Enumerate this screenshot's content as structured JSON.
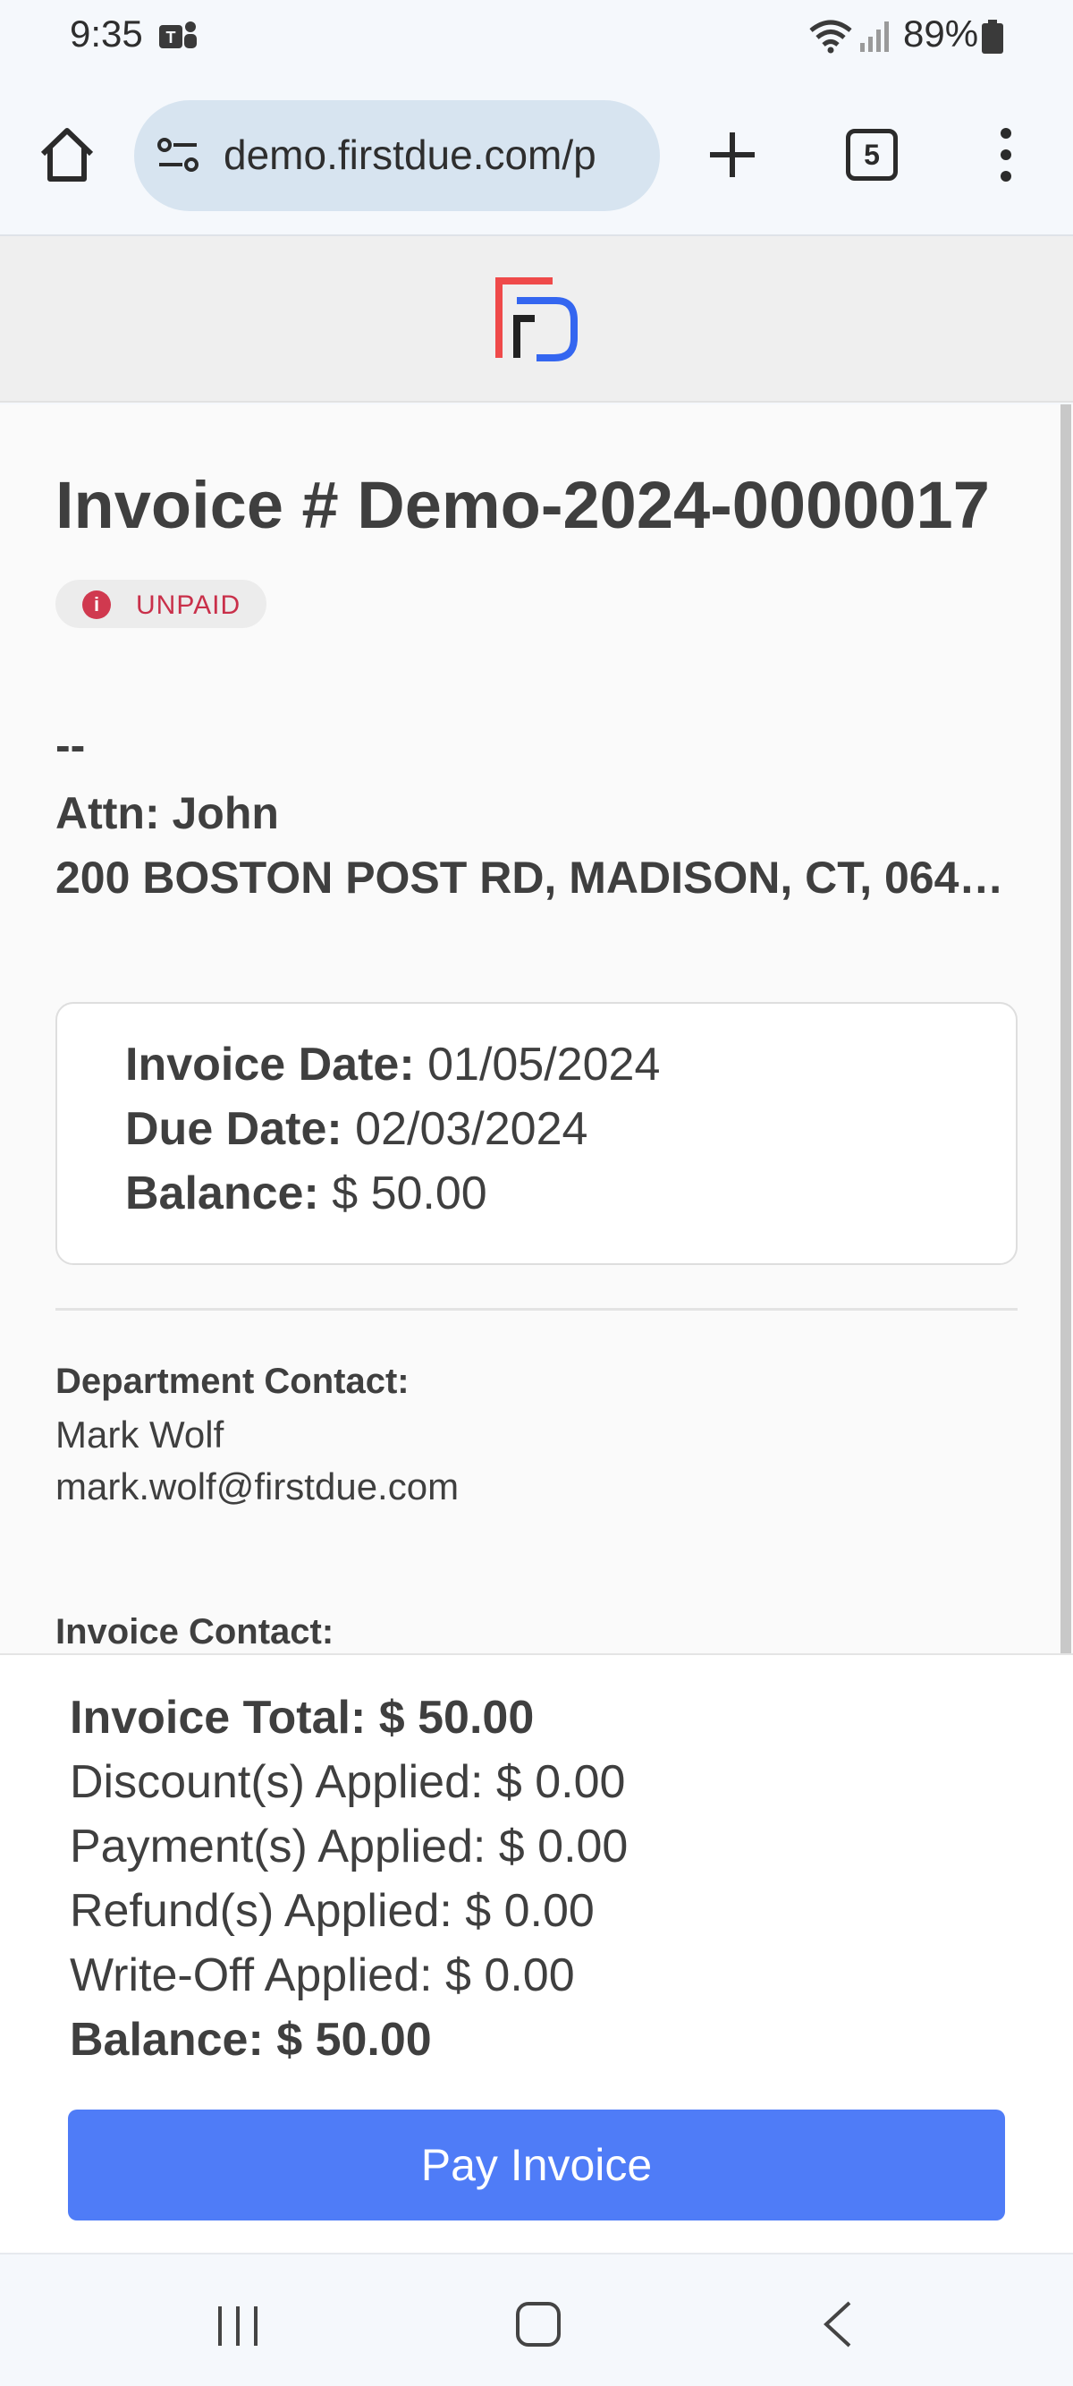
{
  "status_bar": {
    "time": "9:35",
    "battery": "89%"
  },
  "browser": {
    "url": "demo.firstdue.com/p",
    "tab_count": "5"
  },
  "invoice": {
    "title": "Invoice # Demo-2024-0000017",
    "status": "UNPAID",
    "recipient_name": "--",
    "attn": "Attn: John",
    "address": "200 BOSTON POST RD, MADISON, CT, 064…",
    "invoice_date_label": "Invoice Date:",
    "invoice_date": "01/05/2024",
    "due_date_label": "Due Date:",
    "due_date": "02/03/2024",
    "balance_label": "Balance:",
    "balance": "$ 50.00"
  },
  "department_contact": {
    "label": "Department Contact:",
    "name": "Mark Wolf",
    "email": "mark.wolf@firstdue.com"
  },
  "invoice_contact": {
    "label": "Invoice Contact:"
  },
  "summary": {
    "invoice_total": "Invoice Total: $ 50.00",
    "discounts": "Discount(s) Applied: $ 0.00",
    "payments": "Payment(s) Applied: $ 0.00",
    "refunds": "Refund(s) Applied: $ 0.00",
    "write_off": "Write-Off Applied: $ 0.00",
    "balance": "Balance: $ 50.00",
    "pay_button": "Pay Invoice"
  },
  "colors": {
    "accent": "#4f7cf7",
    "unpaid": "#c9304a"
  },
  "icons": [
    "teams-icon",
    "wifi-icon",
    "signal-icon",
    "battery-icon",
    "home-icon",
    "site-settings-icon",
    "plus-icon",
    "tabs-icon",
    "more-icon",
    "firstdue-logo-icon",
    "info-icon",
    "recent-apps-icon",
    "nav-home-icon",
    "back-icon"
  ]
}
